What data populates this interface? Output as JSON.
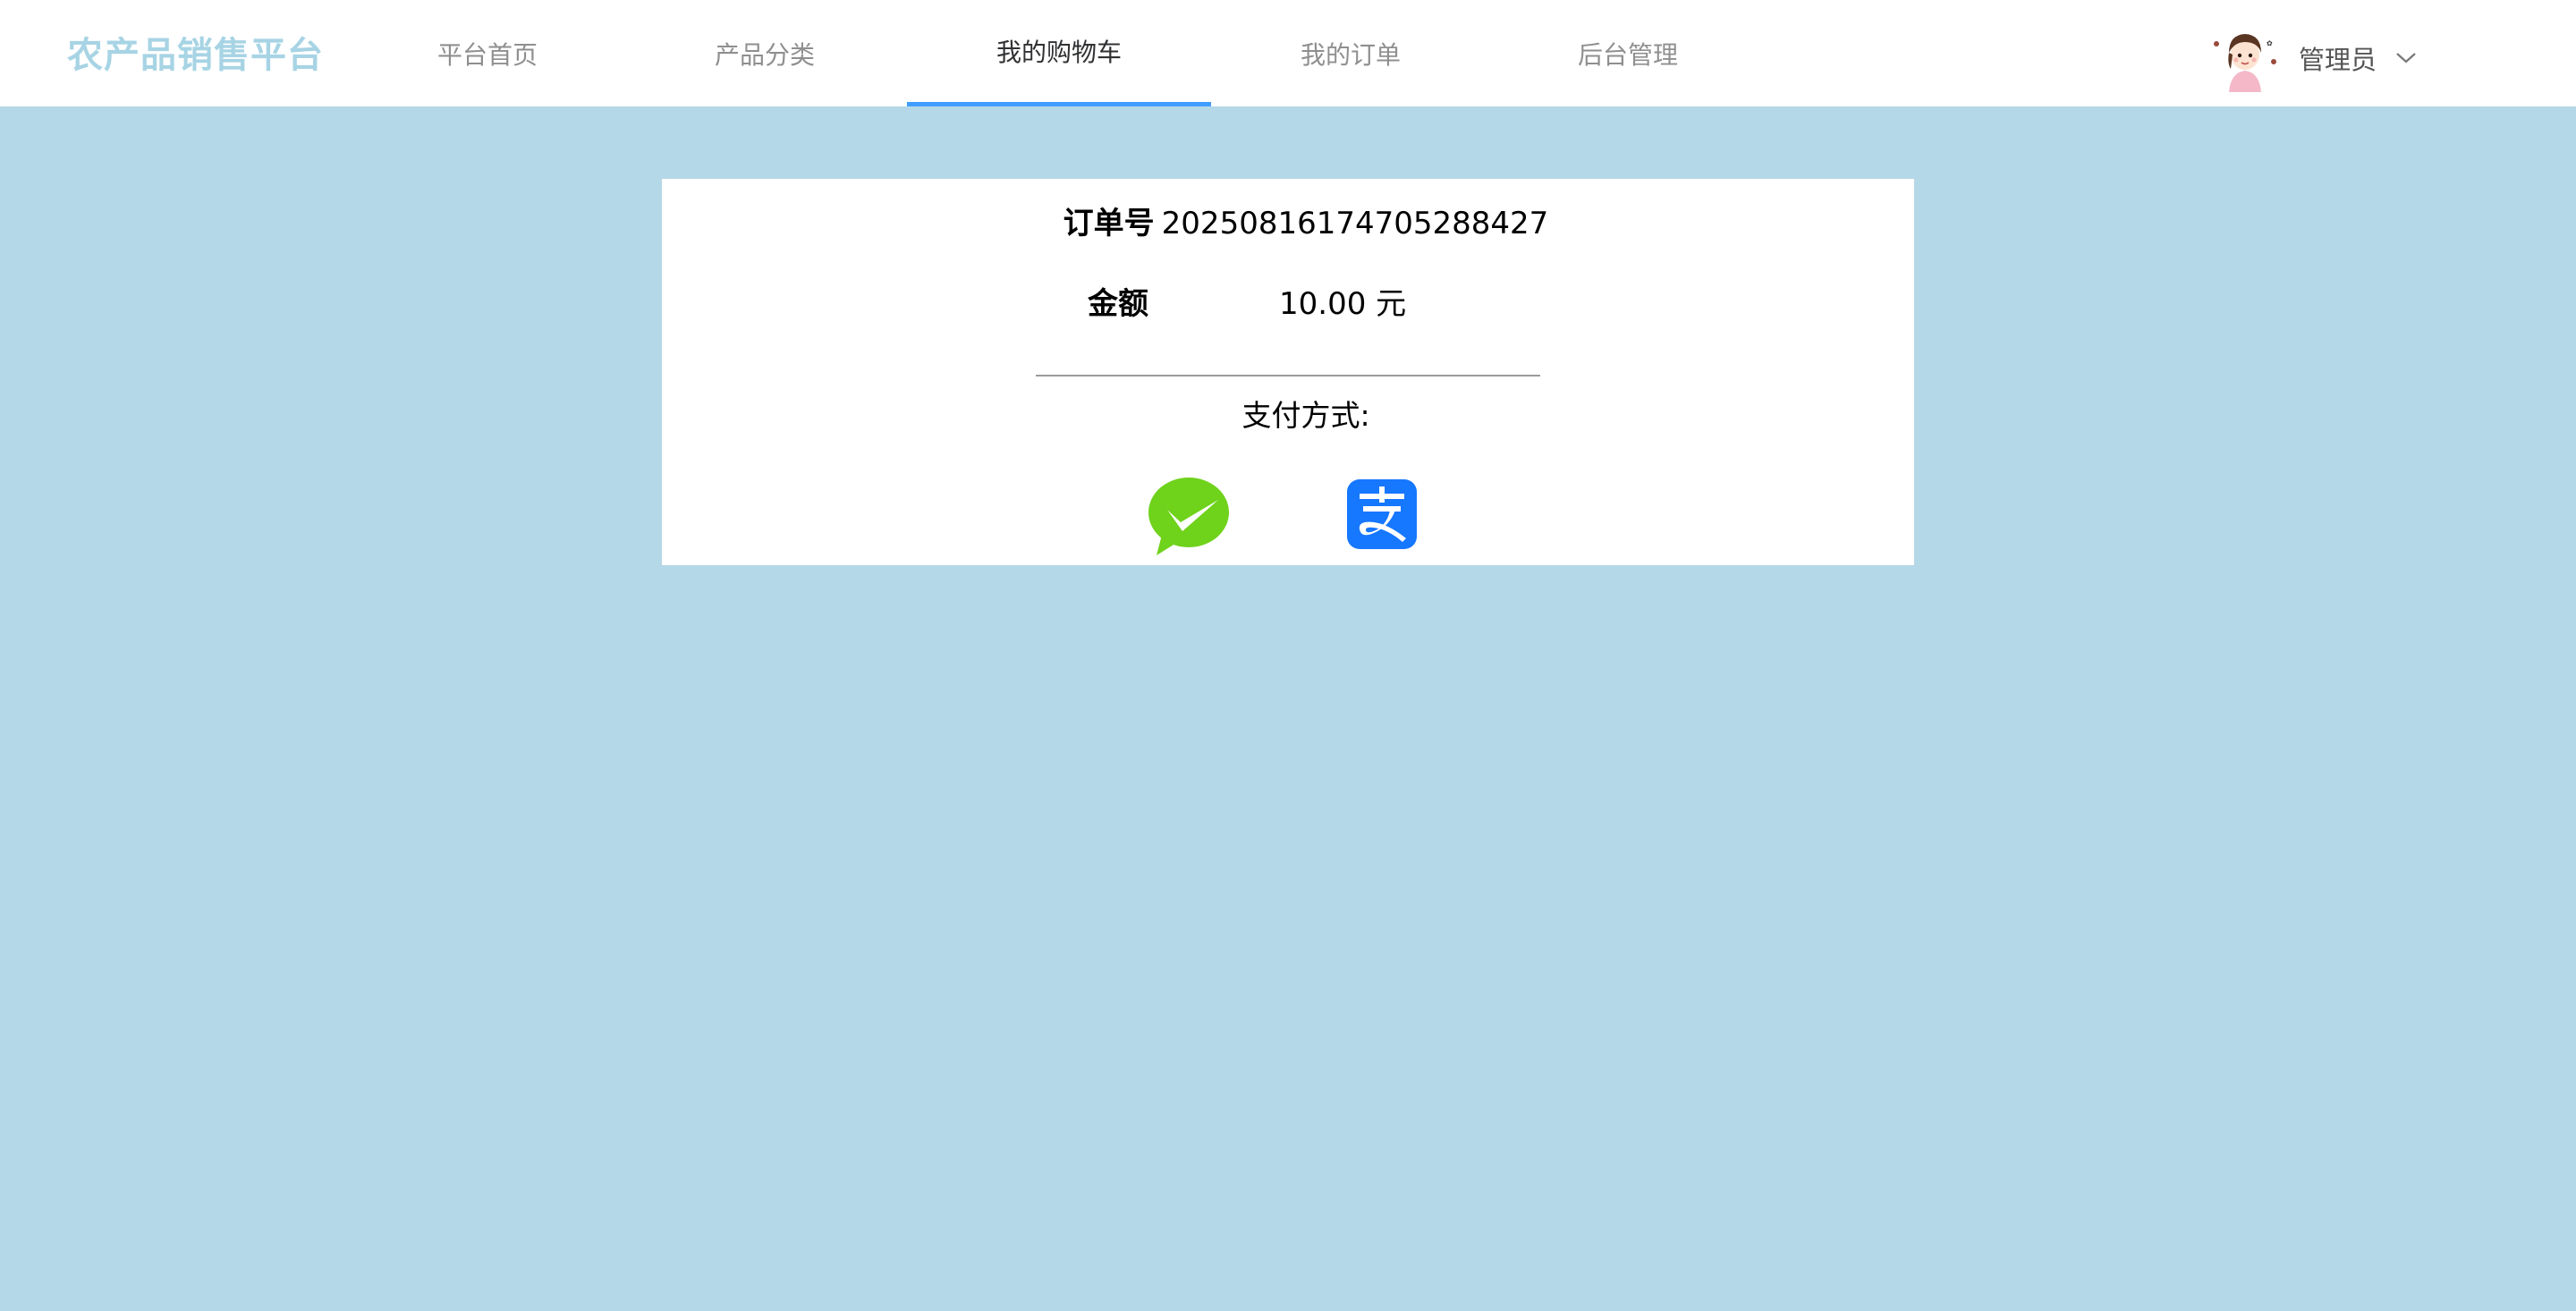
{
  "header": {
    "brand": "农产品销售平台",
    "nav": [
      {
        "label": "平台首页",
        "active": false
      },
      {
        "label": "产品分类",
        "active": false
      },
      {
        "label": "我的购物车",
        "active": true
      },
      {
        "label": "我的订单",
        "active": false
      },
      {
        "label": "后台管理",
        "active": false
      }
    ],
    "user": {
      "name": "管理员",
      "avatar_icon": "cartoon-avatar-icon",
      "dropdown_icon": "chevron-down-icon"
    }
  },
  "payment": {
    "order_label": "订单号",
    "order_number": "20250816174705288427",
    "amount_label": "金额",
    "amount_value": "10.00 元",
    "method_label": "支付方式:",
    "methods": [
      {
        "icon": "wechat-pay-icon",
        "color": "#6fd21b"
      },
      {
        "icon": "alipay-icon",
        "color": "#1677ff"
      }
    ]
  },
  "colors": {
    "background": "#b5d8e8",
    "brand": "#a7d4e4",
    "nav_active_underline": "#409eff"
  }
}
